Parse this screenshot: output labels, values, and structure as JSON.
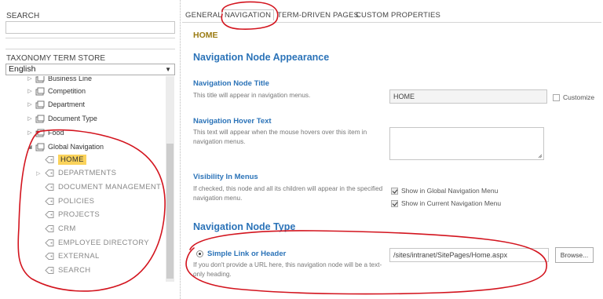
{
  "left_pane": {
    "search_label": "SEARCH",
    "search_value": "",
    "store_label": "TAXONOMY TERM STORE",
    "language": "English",
    "term_sets": [
      "Business Line",
      "Competition",
      "Department",
      "Document Type",
      "Food"
    ],
    "open_set": "Global Navigation",
    "terms": [
      "HOME",
      "DEPARTMENTS",
      "DOCUMENT MANAGEMENT",
      "POLICIES",
      "PROJECTS",
      "CRM",
      "EMPLOYEE DIRECTORY",
      "EXTERNAL",
      "SEARCH"
    ]
  },
  "tabs": [
    "GENERAL",
    "NAVIGATION",
    "TERM-DRIVEN PAGES",
    "CUSTOM PROPERTIES"
  ],
  "active_tab": "NAVIGATION",
  "term_title": "HOME",
  "appearance": {
    "heading": "Navigation Node Appearance",
    "title_label": "Navigation Node Title",
    "title_desc": "This title will appear in navigation menus.",
    "title_value": "HOME",
    "customize_label": "Customize",
    "customize_checked": false,
    "hover_label": "Navigation Hover Text",
    "hover_desc": "This text will appear when the mouse hovers over this item in navigation menus.",
    "hover_value": "",
    "visibility_label": "Visibility In Menus",
    "visibility_desc": "If checked, this node and all its children will appear in the specified navigation menu.",
    "show_global": "Show in Global Navigation Menu",
    "show_global_checked": true,
    "show_current": "Show in Current Navigation Menu",
    "show_current_checked": true
  },
  "node_type": {
    "heading": "Navigation Node Type",
    "option": "Simple Link or Header",
    "option_desc": "If you don't provide a URL here, this navigation node will be a text-only heading.",
    "url_value": "/sites/intranet/SitePages/Home.aspx",
    "browse_label": "Browse..."
  },
  "colors": {
    "accent_blue": "#2b73b8",
    "term_title_gold": "#9a7b12",
    "selected_term_bg": "#fbd35b",
    "annotation_red": "#d3141e"
  }
}
